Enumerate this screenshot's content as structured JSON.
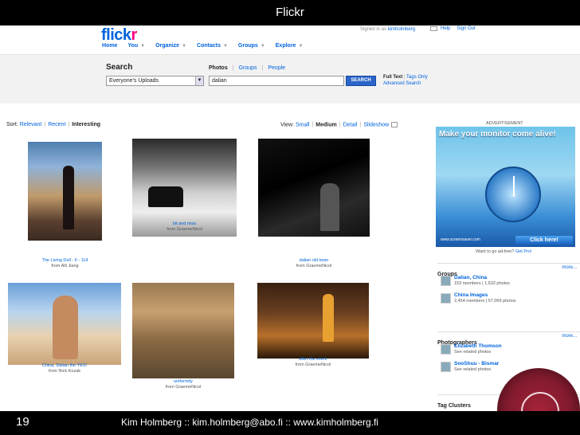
{
  "slide": {
    "title": "Flickr",
    "page_number": "19",
    "credits": "Kim Holmberg  ::  kim.holmberg@abo.fi  ::  www.kimholmberg.fi"
  },
  "header": {
    "logo_main": "flick",
    "logo_accent": "r",
    "signed_in_prefix": "Signed in as",
    "signed_in_user": "kimholmberg",
    "help": "Help",
    "sign_out": "Sign Out",
    "nav": [
      "Home",
      "You",
      "Organize",
      "Contacts",
      "Groups",
      "Explore"
    ]
  },
  "search": {
    "heading": "Search",
    "tabs": {
      "photos": "Photos",
      "groups": "Groups",
      "people": "People"
    },
    "scope": "Everyone's Uploads",
    "query": "dalian",
    "button": "SEARCH",
    "full_text": "Full Text",
    "tags_only": "Tags Only",
    "advanced": "Advanced Search"
  },
  "results": {
    "sort_label": "Sort:",
    "sort": {
      "relevant": "Relevant",
      "recent": "Recent",
      "interesting": "Interesting"
    },
    "view_label": "View:",
    "view": {
      "small": "Small",
      "medium": "Medium",
      "detail": "Detail",
      "slideshow": "Slideshow"
    },
    "photos": [
      {
        "title": "The Living Doll - II - 114",
        "from": "from Alli Jiang"
      },
      {
        "title": "hit and miss",
        "from": "from GraemeNicol"
      },
      {
        "title": "dalian old town",
        "from": "from GraemeNicol"
      },
      {
        "title": "China, Dalian the YES!",
        "from": "from Nick Kozak"
      },
      {
        "title": "uniformity",
        "from": "from GraemeNicol"
      },
      {
        "title": "after the event",
        "from": "from GraemeNicol"
      }
    ]
  },
  "ad": {
    "label": "ADVERTISEMENT",
    "headline": "Make your monitor come alive!",
    "button": "Click here!",
    "logo": "www.screensaver.com",
    "adfree_prefix": "Want to go ad-free?",
    "adfree_link": "Get Pro!"
  },
  "sidebar": {
    "groups": {
      "title": "Groups",
      "more": "more...",
      "items": [
        {
          "name": "Dalian, China",
          "sub": "153 members | 1,632 photos"
        },
        {
          "name": "China Images",
          "sub": "2,454 members | 57,069 photos"
        }
      ]
    },
    "photographers": {
      "title": "Photographers",
      "more": "more...",
      "items": [
        {
          "name": "Elizabeth Thomson",
          "sub": "See related photos"
        },
        {
          "name": "SnoShuu - Bismar",
          "sub": "See related photos"
        }
      ]
    },
    "tag_clusters": {
      "title": "Tag Clusters"
    }
  }
}
